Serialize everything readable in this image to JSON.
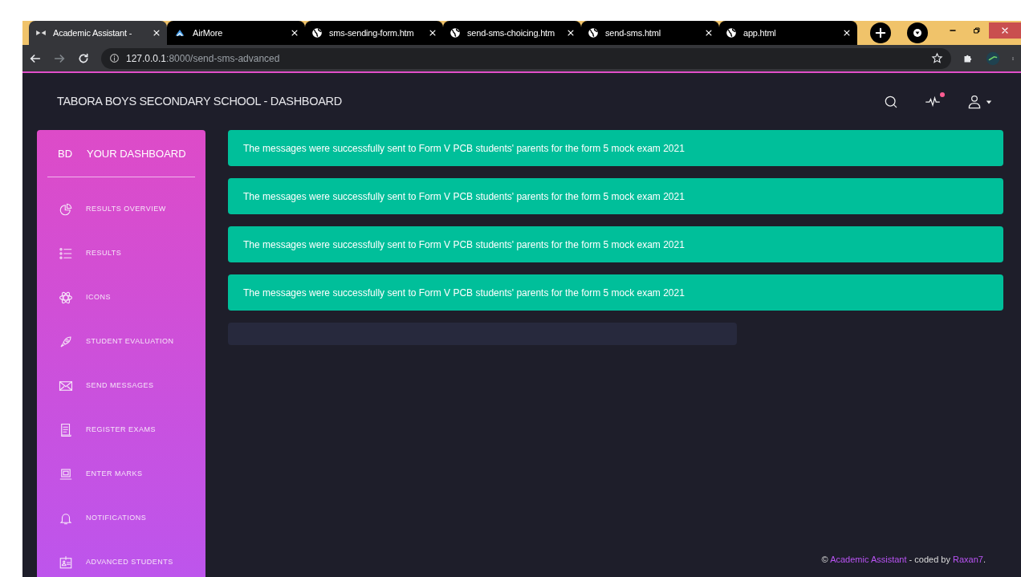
{
  "browser": {
    "tabs": [
      {
        "title": "Academic Assistant -",
        "selected": true
      },
      {
        "title": "AirMore",
        "selected": false
      },
      {
        "title": "sms-sending-form.htm",
        "selected": false
      },
      {
        "title": "send-sms-choicing.htm",
        "selected": false
      },
      {
        "title": "send-sms.html",
        "selected": false
      },
      {
        "title": "app.html",
        "selected": false
      }
    ],
    "url_host": "127.0.0.1",
    "url_rest": ":8000/send-sms-advanced"
  },
  "header": {
    "title": "TABORA BOYS SECONDARY SCHOOL - DASHBOARD",
    "activity_unread": true
  },
  "sidebar": {
    "logo": "BD",
    "title": "YOUR DASHBOARD",
    "items": [
      {
        "label": "RESULTS OVERVIEW"
      },
      {
        "label": "RESULTS"
      },
      {
        "label": "ICONS"
      },
      {
        "label": "STUDENT EVALUATION"
      },
      {
        "label": "SEND MESSAGES"
      },
      {
        "label": "REGISTER EXAMS"
      },
      {
        "label": "ENTER MARKS"
      },
      {
        "label": "NOTIFICATIONS"
      },
      {
        "label": "ADVANCED STUDENTS"
      }
    ]
  },
  "alerts": [
    "The messages were successfully sent to Form V PCB students' parents for the form 5 mock exam 2021",
    "The messages were successfully sent to Form V PCB students' parents for the form 5 mock exam 2021",
    "The messages were successfully sent to Form V PCB students' parents for the form 5 mock exam 2021",
    "The messages were successfully sent to Form V PCB students' parents for the form 5 mock exam 2021"
  ],
  "footer": {
    "symbol": "©",
    "brand": "Academic Assistant",
    "middle": "- coded by",
    "author": "Raxan7",
    "end": "."
  }
}
